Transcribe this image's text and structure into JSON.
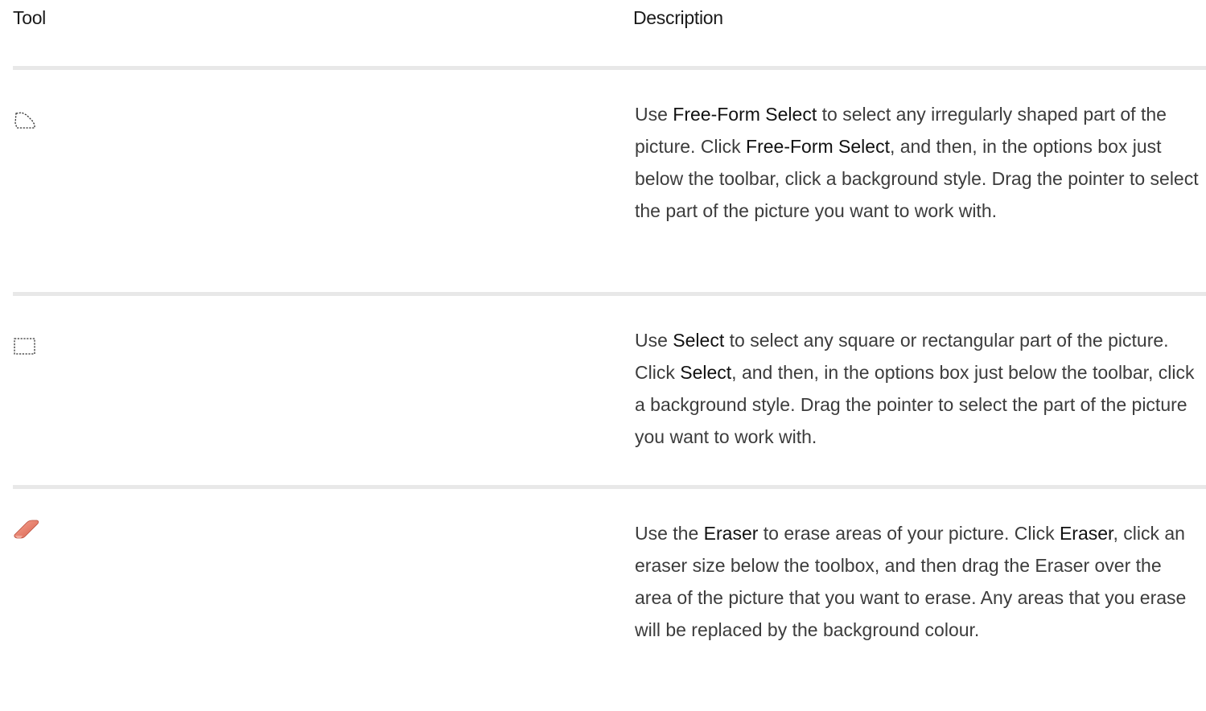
{
  "headers": {
    "tool": "Tool",
    "description": "Description"
  },
  "rows": [
    {
      "icon": "free-form-select-icon",
      "parts": [
        {
          "t": "Use ",
          "b": false
        },
        {
          "t": "Free-Form Select",
          "b": true
        },
        {
          "t": " to select any irregularly shaped part of the picture. Click ",
          "b": false
        },
        {
          "t": "Free-Form Select",
          "b": true
        },
        {
          "t": ", and then, in the options box just below the toolbar, click a background style. Drag the pointer to select the part of the picture you want to work with.",
          "b": false
        }
      ]
    },
    {
      "icon": "select-icon",
      "parts": [
        {
          "t": "Use ",
          "b": false
        },
        {
          "t": "Select",
          "b": true
        },
        {
          "t": " to select any square or rectangular part of the picture. Click ",
          "b": false
        },
        {
          "t": "Select",
          "b": true
        },
        {
          "t": ", and then, in the options box just below the toolbar, click a background style. Drag the pointer to select the part of the picture you want to work with.",
          "b": false
        }
      ]
    },
    {
      "icon": "eraser-icon",
      "parts": [
        {
          "t": "Use the ",
          "b": false
        },
        {
          "t": "Eraser",
          "b": true
        },
        {
          "t": " to erase areas of your picture. Click ",
          "b": false
        },
        {
          "t": "Eraser",
          "b": true
        },
        {
          "t": ", click an eraser size below the toolbox, and then drag the Eraser over the area of the picture that you want to erase. Any areas that you erase will be replaced by the background colour.",
          "b": false
        }
      ]
    }
  ]
}
